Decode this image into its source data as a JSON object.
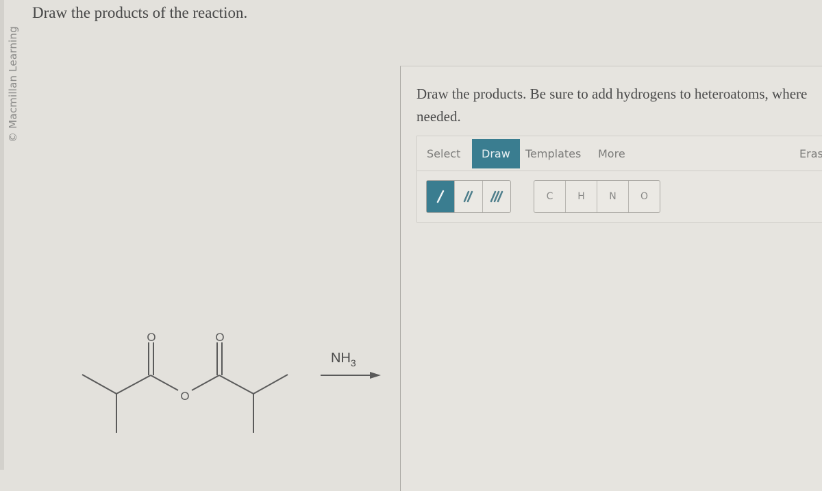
{
  "copyright": "© Macmillan Learning",
  "question": "Draw the products of the reaction.",
  "reaction": {
    "reactant": "isobutyric anhydride",
    "atom_labels": {
      "carbonyl_o_left": "O",
      "carbonyl_o_right": "O",
      "bridging_o": "O"
    },
    "reagent": "NH",
    "reagent_subscript": "3"
  },
  "editor": {
    "instructions": "Draw the products. Be sure to add hydrogens to heteroatoms, where needed.",
    "tabs": [
      {
        "label": "Select",
        "active": false
      },
      {
        "label": "Draw",
        "active": true
      },
      {
        "label": "Templates",
        "active": false
      },
      {
        "label": "More",
        "active": false
      },
      {
        "label": "Eras",
        "active": false
      }
    ],
    "bond_tools": [
      {
        "name": "single-bond",
        "active": true
      },
      {
        "name": "double-bond",
        "active": false
      },
      {
        "name": "triple-bond",
        "active": false
      }
    ],
    "atom_tools": [
      "C",
      "H",
      "N",
      "O"
    ],
    "accent_color": "#3a7d90"
  }
}
